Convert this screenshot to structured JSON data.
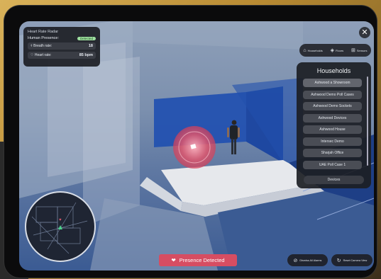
{
  "heart_rate_radar": {
    "title": "Heart Rate Radar",
    "presence_label": "Human Presence:",
    "presence_status": "Detected",
    "breath_label": "Breath rate:",
    "breath_value": "18",
    "heart_label": "Heart rate:",
    "heart_value": "85 bpm"
  },
  "toolbar": {
    "households": "Households",
    "floors": "Floors",
    "sensors": "Sensors"
  },
  "households": {
    "title": "Households",
    "items": [
      "Ashwood a Showroom",
      "Ashwood Demo Poll Cases",
      "Ashwood Demo Sockets",
      "Ashwood Devices",
      "Ashwood House",
      "Intersec Demo",
      "Sharjah Office",
      "UAE Poll Case 1"
    ],
    "footer": "Devices"
  },
  "presence": {
    "label": "Presence Detected"
  },
  "actions": {
    "dismiss": "Dismiss All Alarms",
    "reset": "Reset Camera View"
  },
  "colors": {
    "presence_red": "#d64d62",
    "detected_green": "#9fe0a0",
    "room_blue": "#1f4fb0"
  }
}
